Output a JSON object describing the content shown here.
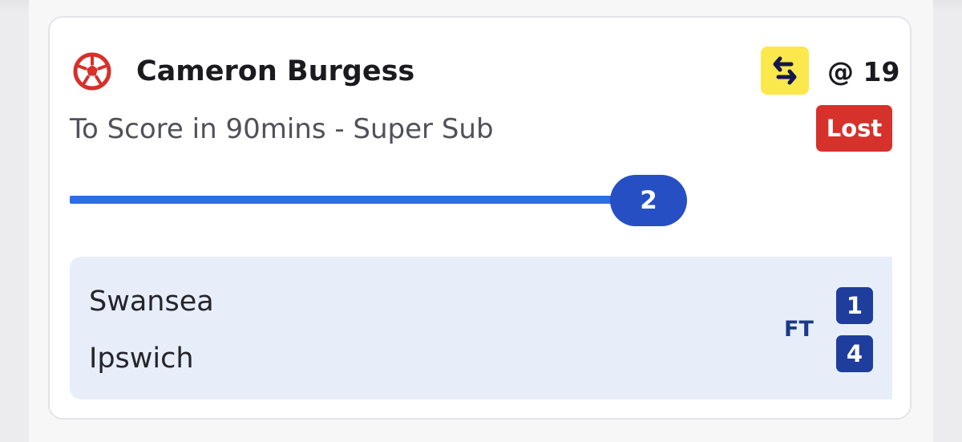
{
  "bet": {
    "player": "Cameron Burgess",
    "odds": "@ 19",
    "market": "To Score in 90mins - Super Sub",
    "status": "Lost",
    "progress_value": "2",
    "icons": {
      "sport": "football-icon",
      "super_sub": "super-sub-swap-icon"
    }
  },
  "match": {
    "home_team": "Swansea",
    "away_team": "Ipswich",
    "status": "FT",
    "home_score": "1",
    "away_score": "4"
  },
  "colors": {
    "lost_badge": "#d6312b",
    "progress": "#2c6ee6",
    "progress_pill": "#274fc4",
    "score_box": "#1f3d9c",
    "super_sub_bg": "#fbe84c",
    "football_icon": "#d6312b",
    "match_bg": "#e7eef9"
  }
}
